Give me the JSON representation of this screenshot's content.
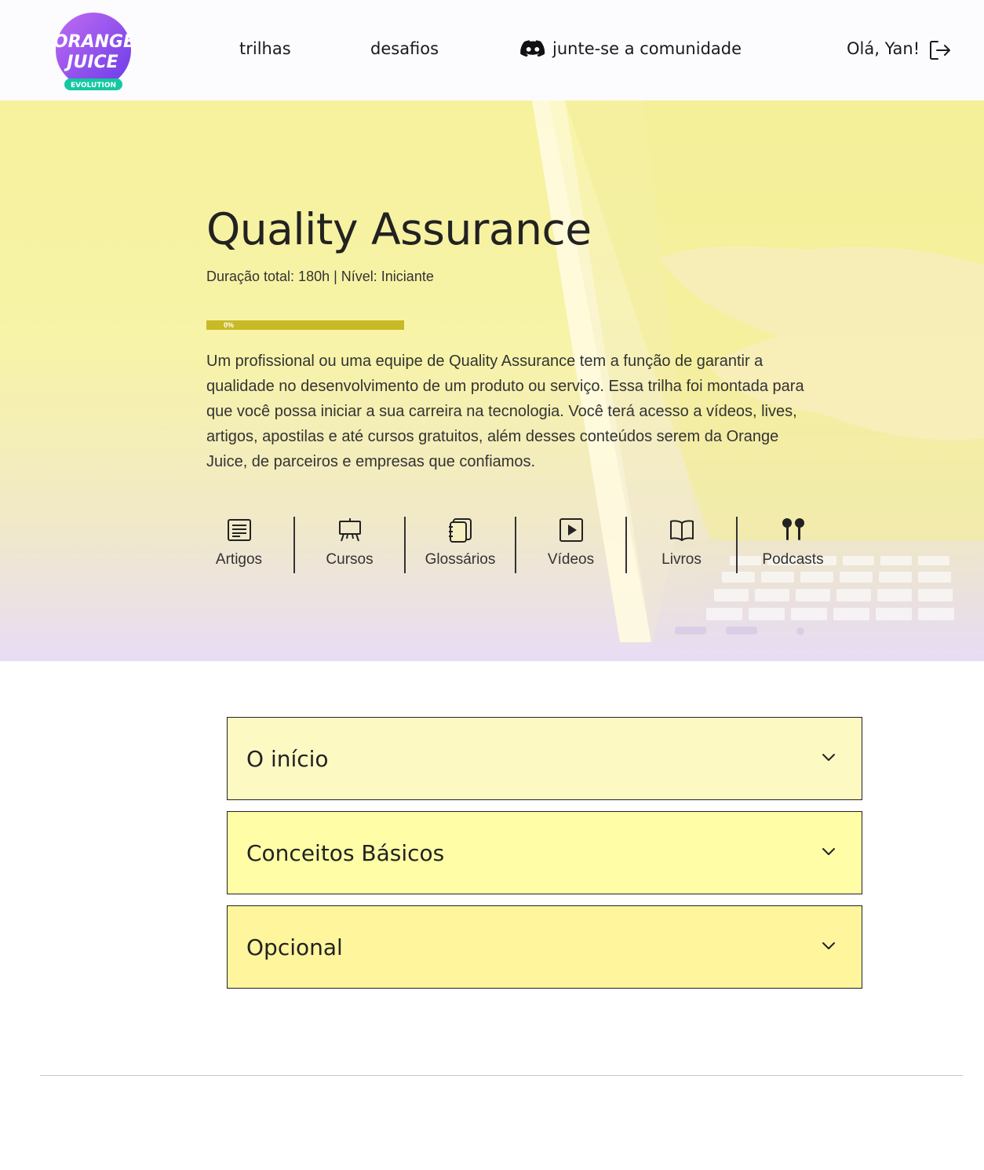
{
  "brand": {
    "logo_line1": "ORANGE",
    "logo_line2": "JUICE",
    "logo_tag": "EVOLUTION",
    "primary_color": "#8a4bf0",
    "tag_color": "#14c8a0"
  },
  "nav": {
    "trilhas": "trilhas",
    "desafios": "desafios",
    "community": "junte-se a comunidade",
    "community_icon": "discord-icon",
    "greeting": "Olá, Yan!",
    "logout_icon": "logout-icon"
  },
  "hero": {
    "title": "Quality Assurance",
    "meta": "Duração total: 180h | Nível: Iniciante",
    "progress_percent": 0,
    "progress_label": "0%",
    "description": "Um profissional ou uma equipe de Quality Assurance tem a função de garantir a qualidade no desenvolvimento de um produto ou serviço. Essa trilha foi montada para que você possa iniciar a sua carreira na tecnologia. Você terá acesso a vídeos, lives, artigos, apostilas e até cursos gratuitos, além desses conteúdos serem da Orange Juice, de parceiros e empresas que confiamos.",
    "categories": [
      {
        "label": "Artigos",
        "icon": "article-icon"
      },
      {
        "label": "Cursos",
        "icon": "presentation-board-icon"
      },
      {
        "label": "Glossários",
        "icon": "notebook-icon"
      },
      {
        "label": "Vídeos",
        "icon": "play-icon"
      },
      {
        "label": "Livros",
        "icon": "open-book-icon"
      },
      {
        "label": "Podcasts",
        "icon": "earbuds-icon"
      }
    ]
  },
  "sections": [
    {
      "title": "O início",
      "icon": "chevron-down-icon"
    },
    {
      "title": "Conceitos Básicos",
      "icon": "chevron-down-icon"
    },
    {
      "title": "Opcional",
      "icon": "chevron-down-icon"
    }
  ],
  "colors": {
    "progress": "#c8b926",
    "section_1_bg": "#fdf9c3",
    "section_2_bg": "#fffea6",
    "section_3_bg": "#fff59c"
  }
}
